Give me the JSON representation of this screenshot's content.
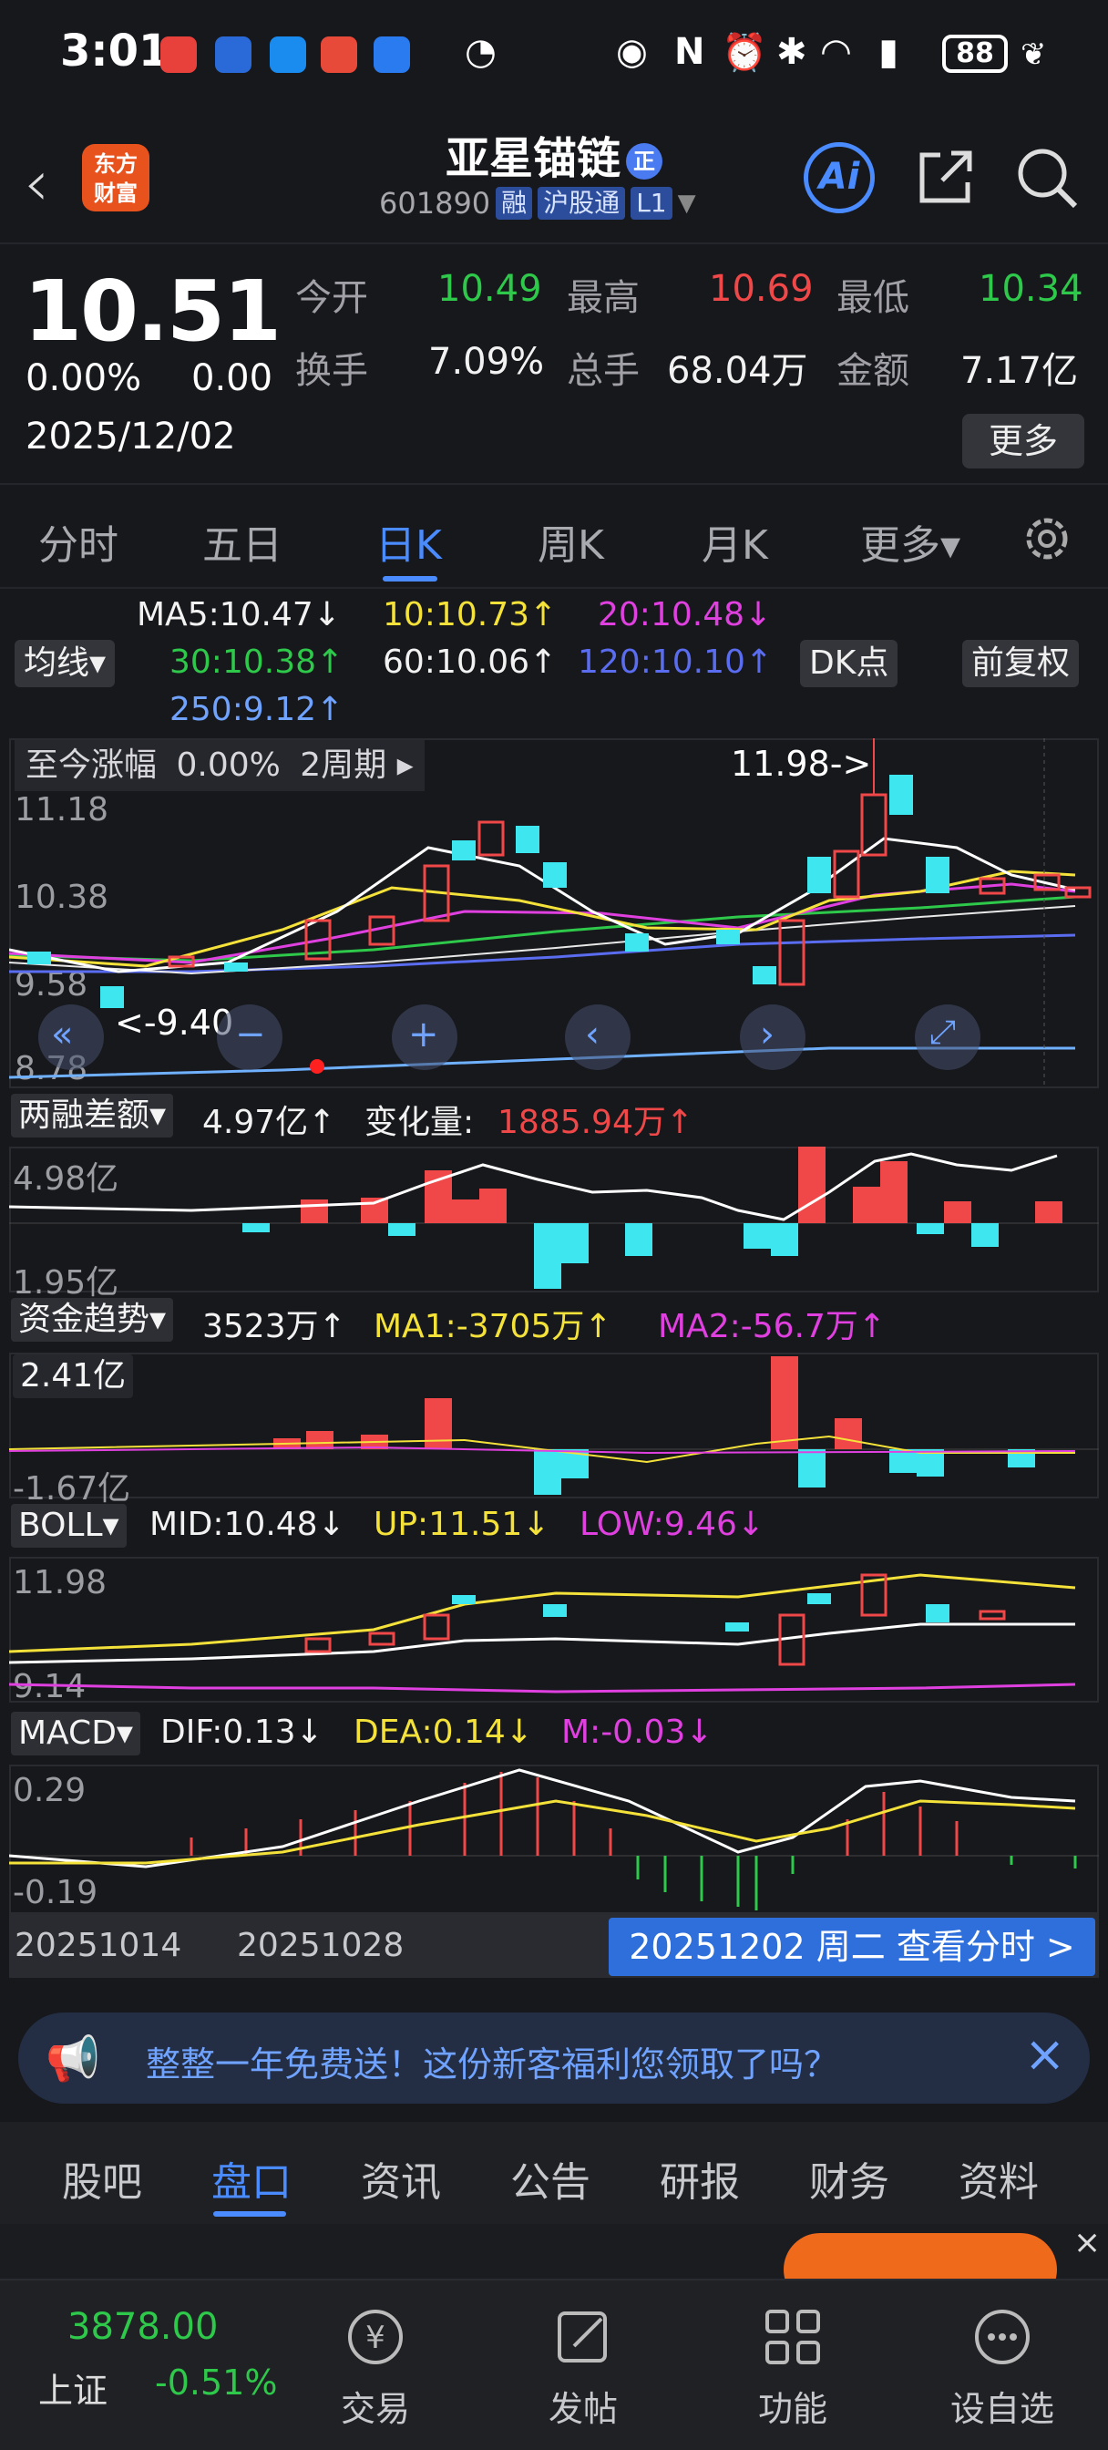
{
  "status": {
    "time": "3:01",
    "battery": "88"
  },
  "header": {
    "logo_line1": "东方",
    "logo_line2": "财富",
    "stock_name": "亚星锚链",
    "name_badge": "正",
    "code": "601890",
    "tags": [
      "融",
      "沪股通",
      "L1"
    ],
    "ai_label": "Ai"
  },
  "quote": {
    "price": "10.51",
    "change_pct": "0.00%",
    "change_abs": "0.00",
    "date": "2025/12/02",
    "open_label": "今开",
    "open": "10.49",
    "high_label": "最高",
    "high": "10.69",
    "low_label": "最低",
    "low": "10.34",
    "turnover_label": "换手",
    "turnover": "7.09%",
    "volume_label": "总手",
    "volume": "68.04万",
    "amount_label": "金额",
    "amount": "7.17亿",
    "more": "更多"
  },
  "ktabs": [
    "分时",
    "五日",
    "日K",
    "周K",
    "月K",
    "更多▾"
  ],
  "ma_legend": {
    "ma5": "MA5:10.47↓",
    "ma10": "10:10.73↑",
    "ma20": "20:10.48↓",
    "ma30": "30:10.38↑",
    "ma60": "60:10.06↑",
    "ma120": "120:10.10↑",
    "ma250": "250:9.12↑",
    "chip_ma": "均线▾",
    "chip_dk": "DK点",
    "chip_fq": "前复权"
  },
  "main_chart": {
    "range_label": "至今涨幅",
    "range_pct": "0.00%",
    "range_period": "2周期 ▸",
    "y_labels": [
      "11.18",
      "10.38",
      "9.58",
      "8.78"
    ],
    "high_marker": "11.98->",
    "low_marker": "<-9.40"
  },
  "margin_panel": {
    "chip": "两融差额▾",
    "value": "4.97亿↑",
    "change_label": "变化量:",
    "change_value": "1885.94万↑",
    "y_top": "4.98亿",
    "y_bottom": "1.95亿"
  },
  "fund_panel": {
    "chip": "资金趋势▾",
    "value": "3523万↑",
    "ma1": "MA1:-3705万↑",
    "ma2": "MA2:-56.7万↑",
    "y_top": "2.41亿",
    "y_bottom": "-1.67亿"
  },
  "boll_panel": {
    "chip": "BOLL▾",
    "mid": "MID:10.48↓",
    "up": "UP:11.51↓",
    "low": "LOW:9.46↓",
    "y_top": "11.98",
    "y_bottom": "9.14"
  },
  "macd_panel": {
    "chip": "MACD▾",
    "dif": "DIF:0.13↓",
    "dea": "DEA:0.14↓",
    "m": "M:-0.03↓",
    "y_top": "0.29",
    "y_bottom": "-0.19"
  },
  "dates": {
    "d1": "20251014",
    "d2": "20251028",
    "button": "20251202 周二 查看分时 >"
  },
  "promo": {
    "text": "整整一年免费送！这份新客福利您领取了吗？"
  },
  "bottom_tabs": [
    "股吧",
    "盘口",
    "资讯",
    "公告",
    "研报",
    "财务",
    "资料"
  ],
  "navbar": {
    "index_value": "3878.00",
    "index_name": "上证",
    "index_change": "-0.51%",
    "items": [
      "交易",
      "发帖",
      "功能",
      "设自选"
    ]
  },
  "colors": {
    "up": "#f04848",
    "down": "#2ec84a",
    "accent": "#4a8cff",
    "cyan_candle": "#3ee6f0"
  }
}
